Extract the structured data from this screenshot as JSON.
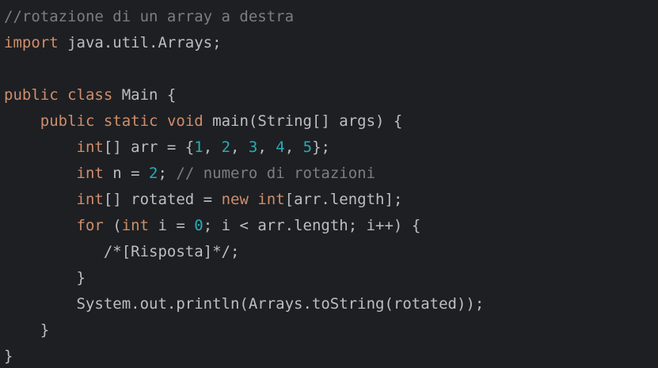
{
  "colors": {
    "background": "#1e1f22",
    "default_text": "#bcbec4",
    "keyword": "#cf8e6d",
    "number": "#2aacb8",
    "comment": "#7a7e85"
  },
  "code": {
    "l1": {
      "comment": "//rotazione di un array a destra"
    },
    "l2": {
      "kw": "import",
      "rest": " java.util.Arrays;"
    },
    "l4": {
      "kw1": "public",
      "sp1": " ",
      "kw2": "class",
      "rest": " Main {"
    },
    "l5": {
      "indent": "    ",
      "kw1": "public",
      "kw2": "static",
      "kw3": "void",
      "rest": " main(String[] args) {"
    },
    "l6": {
      "indent": "        ",
      "kw": "int",
      "pre": "[] arr = {",
      "n1": "1",
      "n2": "2",
      "n3": "3",
      "n4": "4",
      "n5": "5",
      "sep": ", ",
      "post": "};"
    },
    "l7": {
      "indent": "        ",
      "kw": "int",
      "pre": " n = ",
      "num": "2",
      "post": "; ",
      "comment": "// numero di rotazioni"
    },
    "l8": {
      "indent": "        ",
      "kw1": "int",
      "mid1": "[] rotated = ",
      "kw2": "new",
      "sp": " ",
      "kw3": "int",
      "post": "[arr.length];"
    },
    "l9": {
      "indent": "        ",
      "kw1": "for",
      "mid1": " (",
      "kw2": "int",
      "mid2": " i = ",
      "num": "0",
      "post": "; i < arr.length; i++) {"
    },
    "l10": {
      "indent": "           ",
      "text": "/*[Risposta]*/;"
    },
    "l11": {
      "indent": "        ",
      "text": "}"
    },
    "l12": {
      "indent": "        ",
      "text": "System.out.println(Arrays.toString(rotated));"
    },
    "l13": {
      "indent": "    ",
      "text": "}"
    },
    "l14": {
      "text": "}"
    }
  }
}
